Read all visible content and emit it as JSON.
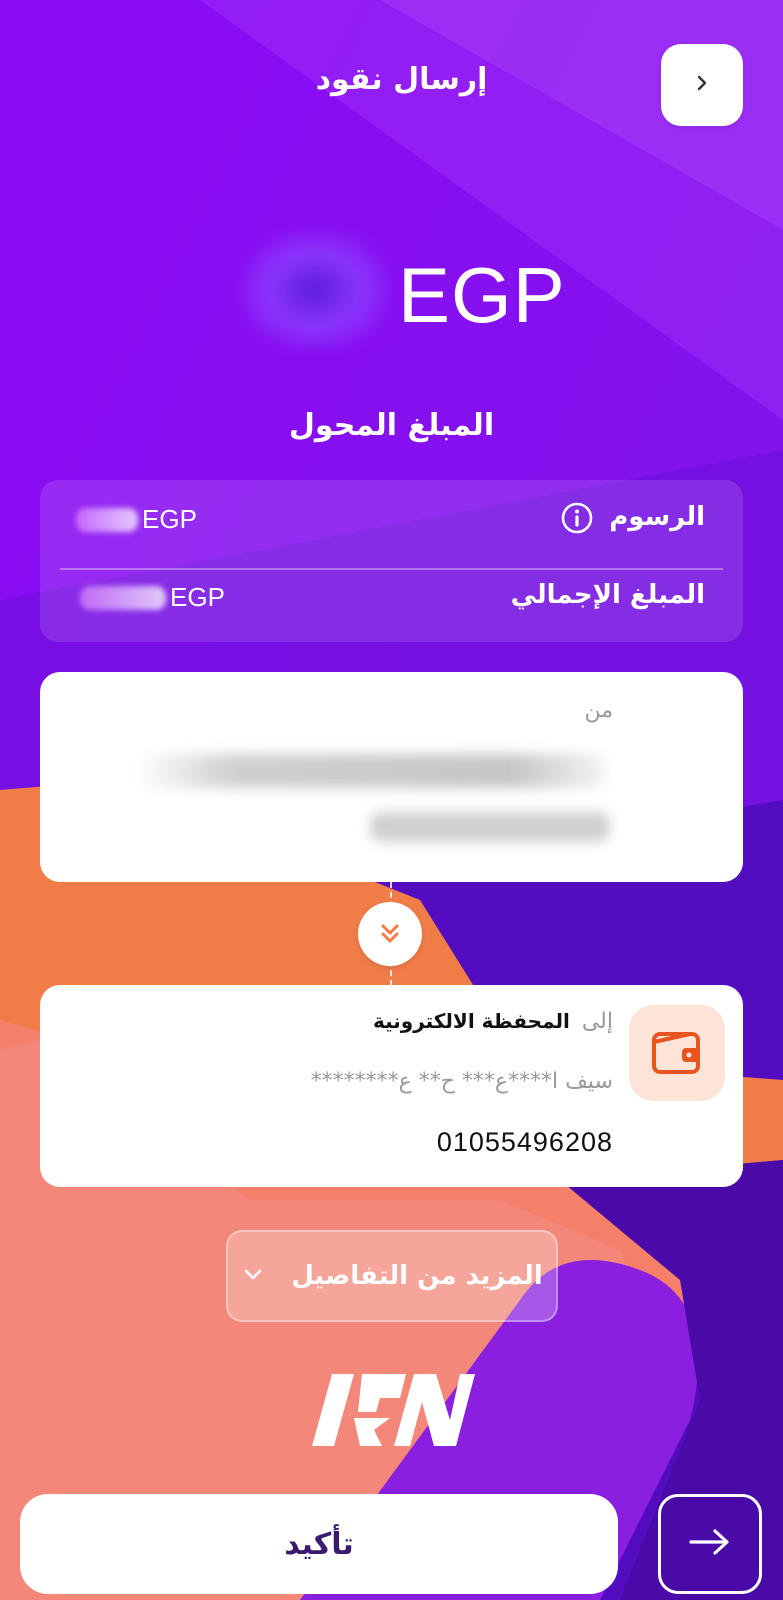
{
  "header": {
    "title": "إرسال نقود",
    "back_icon": "chevron-right-icon"
  },
  "amount": {
    "currency": "EGP",
    "label": "المبلغ المحول"
  },
  "fees": {
    "fees_label": "الرسوم",
    "fees_currency": "EGP",
    "total_label": "المبلغ الإجمالي",
    "total_currency": "EGP",
    "info_icon": "info-icon"
  },
  "from": {
    "label": "من"
  },
  "to": {
    "prefix": "إلى",
    "wallet_label": "المحفظة الالكترونية",
    "masked_name": "سيف ا****ع*** ح** ع********",
    "phone": "01055496208",
    "wallet_icon": "wallet-icon"
  },
  "more_details": {
    "label": "المزيد من التفاصيل",
    "icon": "chevron-down-icon"
  },
  "brand": {
    "logo_text": "IPN"
  },
  "actions": {
    "confirm_label": "تأكيد",
    "arrow_icon": "arrow-right-icon"
  },
  "colors": {
    "purple": "#8a0cf0",
    "deep_purple": "#5a10c8",
    "orange": "#f06a35",
    "salmon": "#f48a78",
    "wallet_orange": "#e8541e"
  }
}
